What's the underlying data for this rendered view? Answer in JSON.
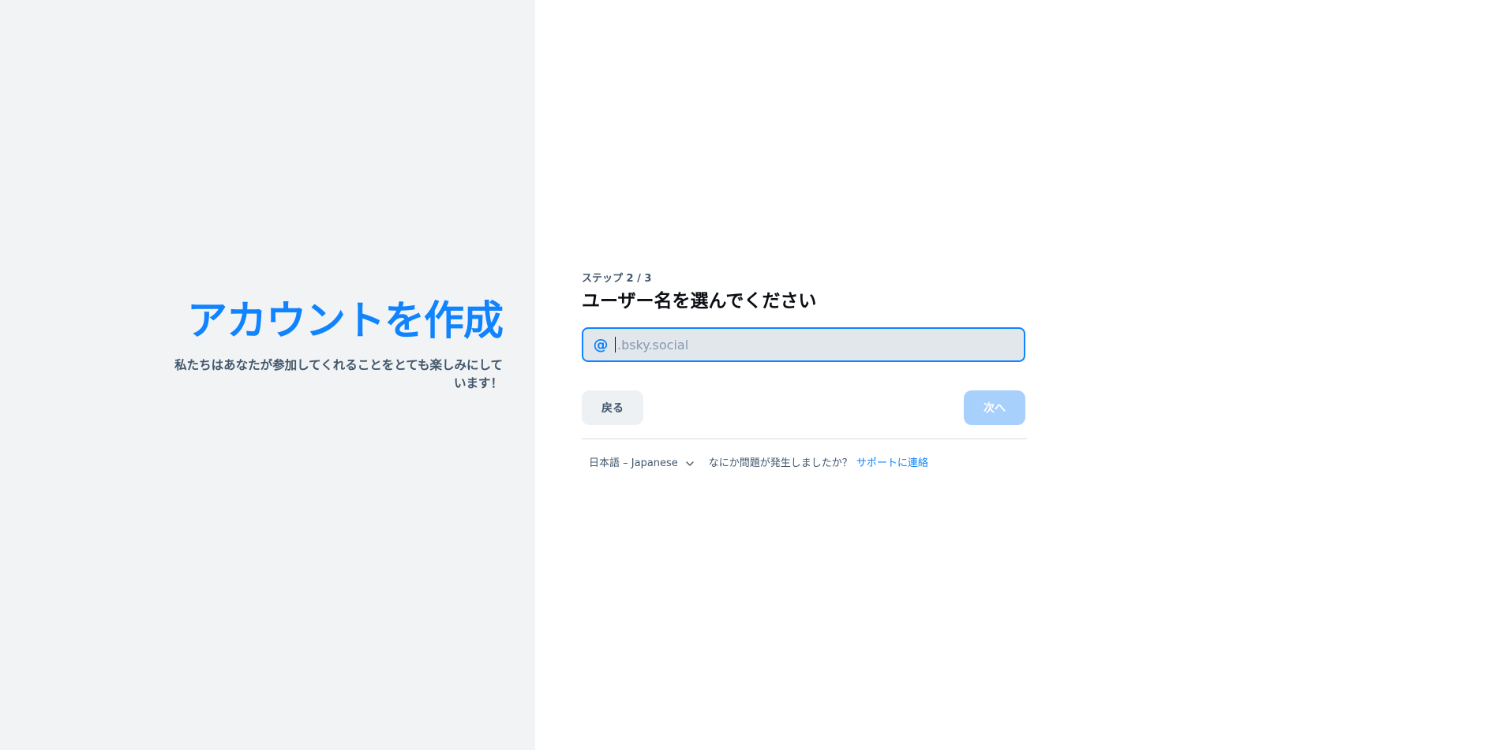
{
  "left": {
    "title": "アカウントを作成",
    "subtitle": "私たちはあなたが参加してくれることをとても楽しみにしています！"
  },
  "form": {
    "step_label": "ステップ 2 / 3",
    "title": "ユーザー名を選んでください",
    "handle_input": {
      "value": "",
      "placeholder": ".bsky.social"
    },
    "back_label": "戻る",
    "next_label": "次へ"
  },
  "footer": {
    "language": "日本語 – Japanese",
    "help_text": "なにか問題が発生しましたか？",
    "support_link": "サポートに連絡"
  },
  "icons": {
    "at": "at-icon",
    "chevron": "chevron-down-icon"
  },
  "colors": {
    "accent": "#1083fe",
    "left_bg": "#f1f3f5",
    "input_bg": "#e2e7ec",
    "next_disabled": "#a8d0fd"
  }
}
